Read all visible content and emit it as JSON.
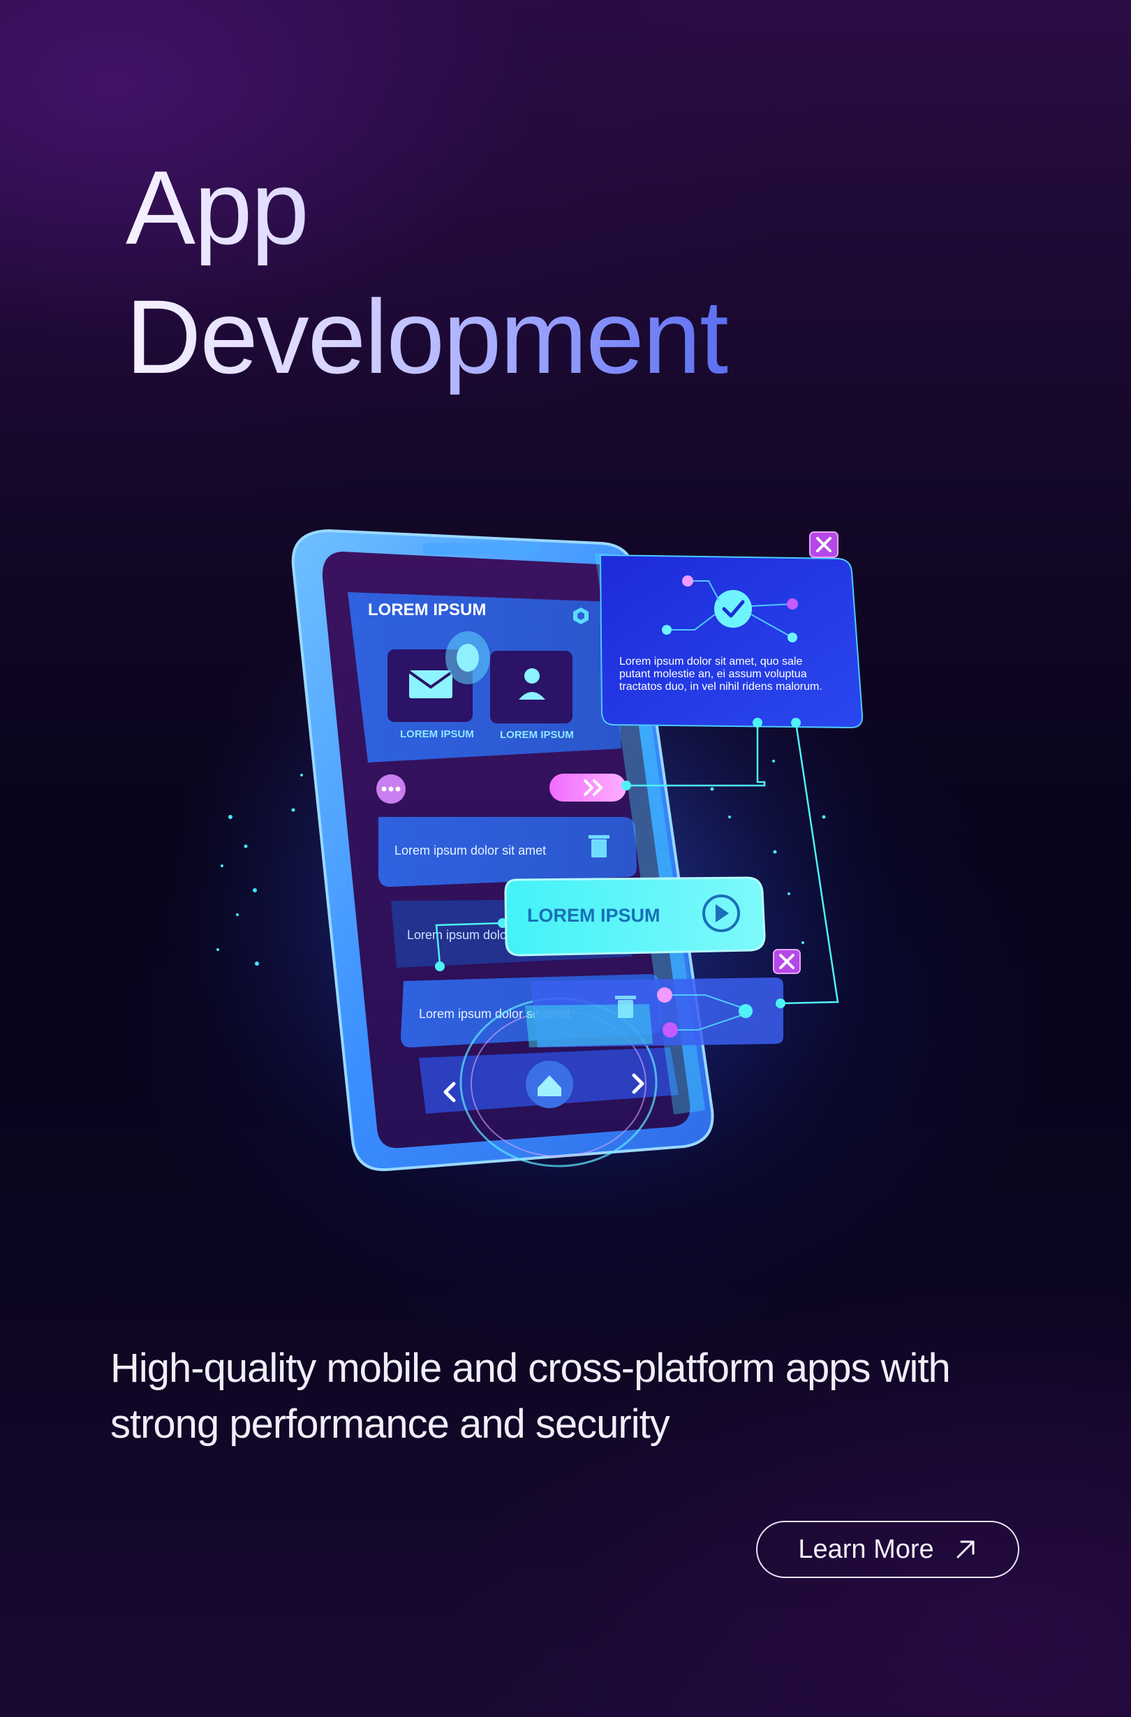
{
  "hero": {
    "title_line1": "App",
    "title_line2": "Development"
  },
  "illustration": {
    "header_label": "LOREM IPSUM",
    "tile_mail_label": "LOREM IPSUM",
    "tile_user_label": "LOREM IPSUM",
    "list_item_1": "Lorem ipsum dolor sit amet",
    "list_item_2": "Lorem ipsum dolor",
    "list_item_3": "Lorem ipsum dolor sit amet",
    "floating_button_label": "LOREM IPSUM",
    "popup_text_line1": "Lorem ipsum dolor sit amet, quo sale",
    "popup_text_line2": "putant molestie an, ei assum voluptua",
    "popup_text_line3": "tractatos duo, in vel nihil ridens malorum."
  },
  "tagline": {
    "line1": "High-quality mobile and cross-platform apps with",
    "line2": "strong performance and security"
  },
  "cta": {
    "label": "Learn More"
  },
  "colors": {
    "accent_cyan": "#3ff0f5",
    "accent_blue": "#3d7dff",
    "accent_magenta": "#c04cff",
    "text_light": "#f1eefb"
  },
  "icons": [
    "mail-icon",
    "user-icon",
    "trash-icon",
    "play-icon",
    "check-icon",
    "close-icon",
    "home-icon",
    "chevron-left-icon",
    "chevron-right-icon",
    "double-chevron-right-icon",
    "more-dots-icon",
    "hexagon-icon",
    "arrow-up-right-icon"
  ]
}
